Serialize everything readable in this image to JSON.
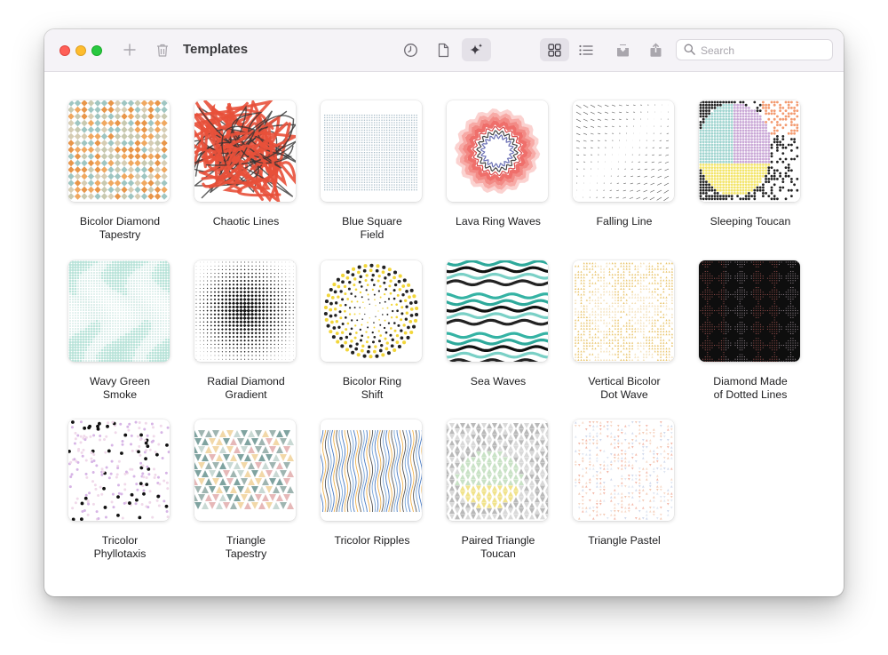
{
  "window": {
    "title": "Templates"
  },
  "toolbar": {
    "search_placeholder": "Search",
    "icons": [
      "plus-icon",
      "trash-icon",
      "clock-icon",
      "document-icon",
      "sparkles-icon",
      "grid-view-icon",
      "list-view-icon",
      "import-icon",
      "share-icon",
      "search-icon"
    ]
  },
  "templates": [
    {
      "line1": "Bicolor Diamond",
      "line2": "Tapestry"
    },
    {
      "line1": "Chaotic Lines",
      "line2": ""
    },
    {
      "line1": "Blue Square",
      "line2": "Field"
    },
    {
      "line1": "Lava Ring Waves",
      "line2": ""
    },
    {
      "line1": "Falling Line",
      "line2": ""
    },
    {
      "line1": "Sleeping Toucan",
      "line2": ""
    },
    {
      "line1": "Wavy Green",
      "line2": "Smoke"
    },
    {
      "line1": "Radial Diamond",
      "line2": "Gradient"
    },
    {
      "line1": "Bicolor Ring",
      "line2": "Shift"
    },
    {
      "line1": "Sea Waves",
      "line2": ""
    },
    {
      "line1": "Vertical Bicolor",
      "line2": "Dot Wave"
    },
    {
      "line1": "Diamond Made",
      "line2": "of Dotted Lines"
    },
    {
      "line1": "Tricolor",
      "line2": "Phyllotaxis"
    },
    {
      "line1": "Triangle",
      "line2": "Tapestry"
    },
    {
      "line1": "Tricolor Ripples",
      "line2": ""
    },
    {
      "line1": "Paired Triangle",
      "line2": "Toucan"
    },
    {
      "line1": "Triangle Pastel",
      "line2": ""
    }
  ]
}
